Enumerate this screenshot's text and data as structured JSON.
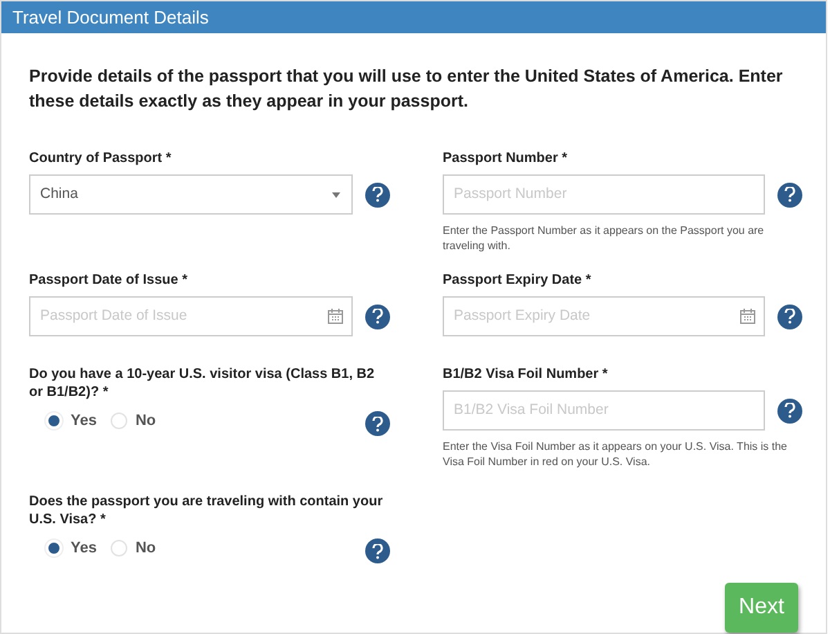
{
  "panel": {
    "title": "Travel Document Details"
  },
  "intro": "Provide details of the passport that you will use to enter the United States of America. Enter these details exactly as they appear in your passport.",
  "left_column": [
    {
      "kind": "select",
      "label": "Country of Passport *",
      "value": "China"
    },
    {
      "kind": "date",
      "label": "Passport Date of Issue *",
      "placeholder": "Passport Date of Issue"
    },
    {
      "kind": "radio",
      "label": "Do you have a 10-year U.S. visitor visa (Class B1, B2 or B1/B2)? *",
      "options": [
        {
          "label": "Yes",
          "selected": true
        },
        {
          "label": "No",
          "selected": false
        }
      ]
    },
    {
      "kind": "radio",
      "label": "Does the passport you are traveling with contain your U.S. Visa? *",
      "options": [
        {
          "label": "Yes",
          "selected": true
        },
        {
          "label": "No",
          "selected": false
        }
      ]
    }
  ],
  "right_column": [
    {
      "kind": "text",
      "label": "Passport Number *",
      "placeholder": "Passport Number",
      "hint": "Enter the Passport Number as it appears on the Passport you are traveling with."
    },
    {
      "kind": "date",
      "label": "Passport Expiry Date *",
      "placeholder": "Passport Expiry Date"
    },
    {
      "kind": "text",
      "label": "B1/B2 Visa Foil Number *",
      "placeholder": "B1/B2 Visa Foil Number",
      "hint": "Enter the Visa Foil Number as it appears on your U.S. Visa. This is the Visa Foil Number in red on your U.S. Visa."
    }
  ],
  "next_button": "Next"
}
